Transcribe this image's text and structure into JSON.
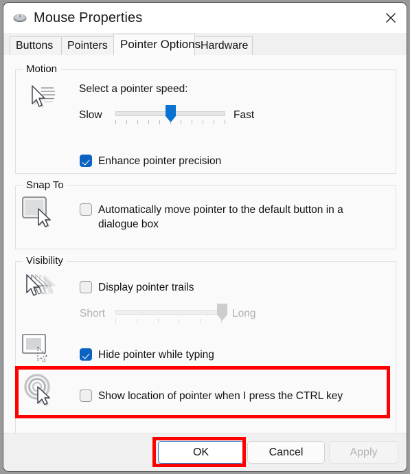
{
  "window": {
    "title": "Mouse Properties",
    "icon": "mouse-icon",
    "close_icon": "close-icon"
  },
  "tabs": [
    {
      "label": "Buttons",
      "active": false
    },
    {
      "label": "Pointers",
      "active": false
    },
    {
      "label": "Pointer Options",
      "active": true
    },
    {
      "label": "Hardware",
      "active": false
    }
  ],
  "groups": {
    "motion": {
      "title": "Motion",
      "icon": "pointer-speed-icon",
      "speed_label": "Select a pointer speed:",
      "slider_min_label": "Slow",
      "slider_max_label": "Fast",
      "slider_value": 5,
      "slider_min": 0,
      "slider_max": 10,
      "slider_ticks": 11,
      "enhance_precision_label": "Enhance pointer precision",
      "enhance_precision_checked": true
    },
    "snap_to": {
      "title": "Snap To",
      "icon": "snap-to-default-button-icon",
      "auto_move_label": "Automatically move pointer to the default button in a dialogue box",
      "auto_move_checked": false
    },
    "visibility": {
      "title": "Visibility",
      "trails_icon": "pointer-trails-icon",
      "trails_label": "Display pointer trails",
      "trails_checked": false,
      "trails_min_label": "Short",
      "trails_max_label": "Long",
      "trails_value": 5,
      "trails_min": 0,
      "trails_max": 5,
      "trails_ticks": 6,
      "trails_disabled": true,
      "hide_icon": "hide-pointer-typing-icon",
      "hide_label": "Hide pointer while typing",
      "hide_checked": true,
      "ctrl_icon": "show-pointer-location-icon",
      "ctrl_label": "Show location of pointer when I press the CTRL key",
      "ctrl_checked": false
    }
  },
  "buttons": {
    "ok": "OK",
    "cancel": "Cancel",
    "apply": "Apply",
    "apply_disabled": true,
    "ok_focused": true
  },
  "annotations": {
    "highlight_color": "#ff0000",
    "highlighted": [
      "show-pointer-location-row",
      "ok-button"
    ]
  }
}
